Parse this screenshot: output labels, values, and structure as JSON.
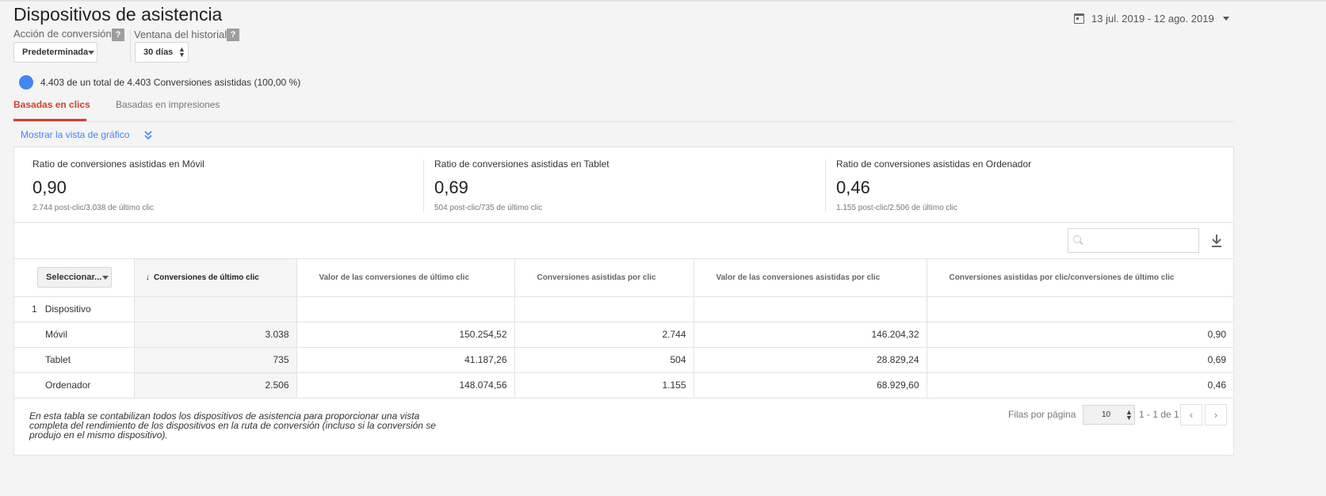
{
  "header": {
    "title": "Dispositivos de asistencia",
    "date_range": "13 jul. 2019 - 12 ago. 2019"
  },
  "controls": {
    "conversion_action": {
      "label": "Acción de conversión",
      "value": "Predeterminada"
    },
    "lookback_window": {
      "label": "Ventana del historial",
      "value": "30 días"
    },
    "help_glyph": "?"
  },
  "segment": {
    "text": "4.403 de un total de 4.403 Conversiones asistidas (100,00 %)",
    "color": "#4285f4"
  },
  "tabs": [
    {
      "label": "Basadas en clics",
      "active": true
    },
    {
      "label": "Basadas en impresiones",
      "active": false
    }
  ],
  "chart_toggle": "Mostrar la vista de gráfico",
  "kpis": [
    {
      "title": "Ratio de conversiones asistidas en Móvil",
      "value": "0,90",
      "sub": "2.744 post-clic/3.038 de último clic"
    },
    {
      "title": "Ratio de conversiones asistidas en Tablet",
      "value": "0,69",
      "sub": "504 post-clic/735 de último clic"
    },
    {
      "title": "Ratio de conversiones asistidas en Ordenador",
      "value": "0,46",
      "sub": "1.155 post-clic/2.506 de último clic"
    }
  ],
  "table": {
    "select_label": "Seleccionar...",
    "sort_arrow": "↓",
    "columns": [
      "Conversiones de último clic",
      "Valor de las conversiones de último clic",
      "Conversiones asistidas por clic",
      "Valor de las conversiones asistidas por clic",
      "Conversiones asistidas por clic/conversiones de último clic"
    ],
    "dimension_index": "1",
    "dimension_label": "Dispositivo",
    "rows": [
      {
        "device": "Móvil",
        "values": [
          "3.038",
          "150.254,52",
          "2.744",
          "146.204,32",
          "0,90"
        ]
      },
      {
        "device": "Tablet",
        "values": [
          "735",
          "41.187,26",
          "504",
          "28.829,24",
          "0,69"
        ]
      },
      {
        "device": "Ordenador",
        "values": [
          "2.506",
          "148.074,56",
          "1.155",
          "68.929,60",
          "0,46"
        ]
      }
    ]
  },
  "footer": {
    "note": "En esta tabla se contabilizan todos los dispositivos de asistencia para proporcionar una vista completa del rendimiento de los dispositivos en la ruta de conversión (incluso si la conversión se produjo en el mismo dispositivo).",
    "rows_per_page_label": "Filas por página",
    "rows_per_page": "10",
    "range": "1 - 1 de 1",
    "prev_glyph": "‹",
    "next_glyph": "›"
  },
  "colors": {
    "accent_red": "#d23f31",
    "link_blue": "#4285f4"
  }
}
